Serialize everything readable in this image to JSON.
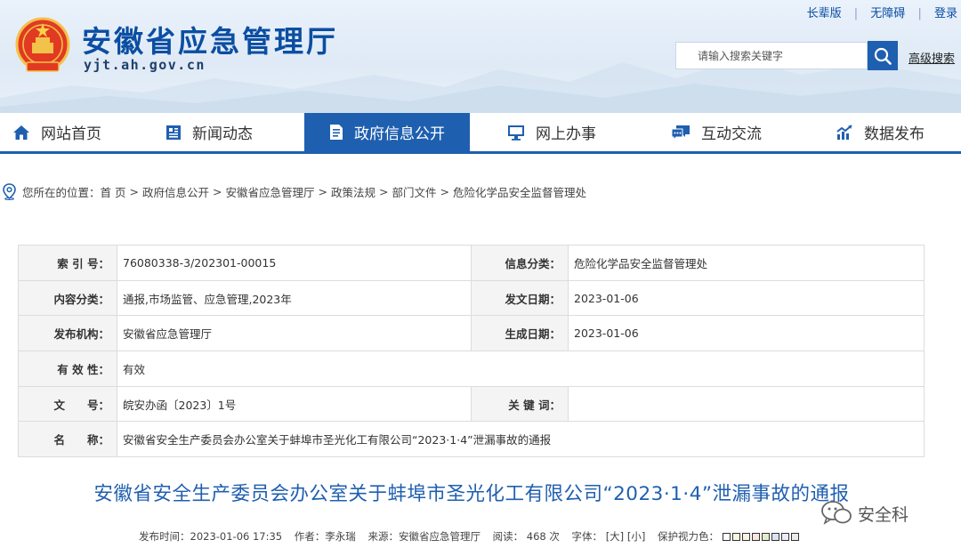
{
  "header": {
    "site_title": "安徽省应急管理厅",
    "site_domain": "yjt.ah.gov.cn",
    "top_links": [
      "长辈版",
      "无障碍",
      "登录"
    ],
    "search_placeholder": "请输入搜索关键字",
    "advanced_search": "高级搜索",
    "brand_color": "#0b4ea2"
  },
  "nav": {
    "active_color": "#1f5fb0",
    "items": [
      {
        "label": "网站首页",
        "icon": "home-icon"
      },
      {
        "label": "新闻动态",
        "icon": "news-icon"
      },
      {
        "label": "政府信息公开",
        "icon": "document-icon",
        "active": true
      },
      {
        "label": "网上办事",
        "icon": "monitor-icon"
      },
      {
        "label": "互动交流",
        "icon": "chat-icon"
      },
      {
        "label": "数据发布",
        "icon": "chart-icon"
      }
    ]
  },
  "breadcrumb": {
    "prefix": "您所在的位置：",
    "items": [
      "首 页",
      "政府信息公开",
      "安徽省应急管理厅",
      "政策法规",
      "部门文件",
      "危险化学品安全监督管理处"
    ]
  },
  "info": {
    "index_label": "索 引 号：",
    "index_value": "76080338-3/202301-00015",
    "category_label": "信息分类：",
    "category_value": "危险化学品安全监督管理处",
    "content_label": "内容分类：",
    "content_value": "通报,市场监管、应急管理,2023年",
    "issue_date_label": "发文日期：",
    "issue_date_value": "2023-01-06",
    "org_label": "发布机构：",
    "org_value": "安徽省应急管理厅",
    "gen_date_label": "生成日期：",
    "gen_date_value": "2023-01-06",
    "validity_label": "有 效 性：",
    "validity_value": "有效",
    "doc_no_label": "文　　号：",
    "doc_no_value": "皖安办函〔2023〕1号",
    "keywords_label": "关 键 词：",
    "keywords_value": "",
    "name_label": "名　　称：",
    "name_value": "安徽省安全生产委员会办公室关于蚌埠市圣光化工有限公司“2023·1·4”泄漏事故的通报"
  },
  "article": {
    "title": "安徽省安全生产委员会办公室关于蚌埠市圣光化工有限公司“2023·1·4”泄漏事故的通报",
    "publish_time": "发布时间：2023-01-06 17:35",
    "author": "作者：李永瑞",
    "source": "来源：安徽省应急管理厅",
    "views_label": "阅读：",
    "views_value": "468",
    "views_unit": "次",
    "font_label": "字体：",
    "font_large": "[大]",
    "font_small": "[小]",
    "eye_label": "保护视力色：",
    "eye_colors": [
      "#ffffff",
      "#faf9de",
      "#fff2e2",
      "#fde6e0",
      "#e3edcd",
      "#dce2f1",
      "#e9ebfe",
      "#eaeaef"
    ]
  },
  "watermark": {
    "text": "安全科",
    "icon": "wechat-icon"
  }
}
